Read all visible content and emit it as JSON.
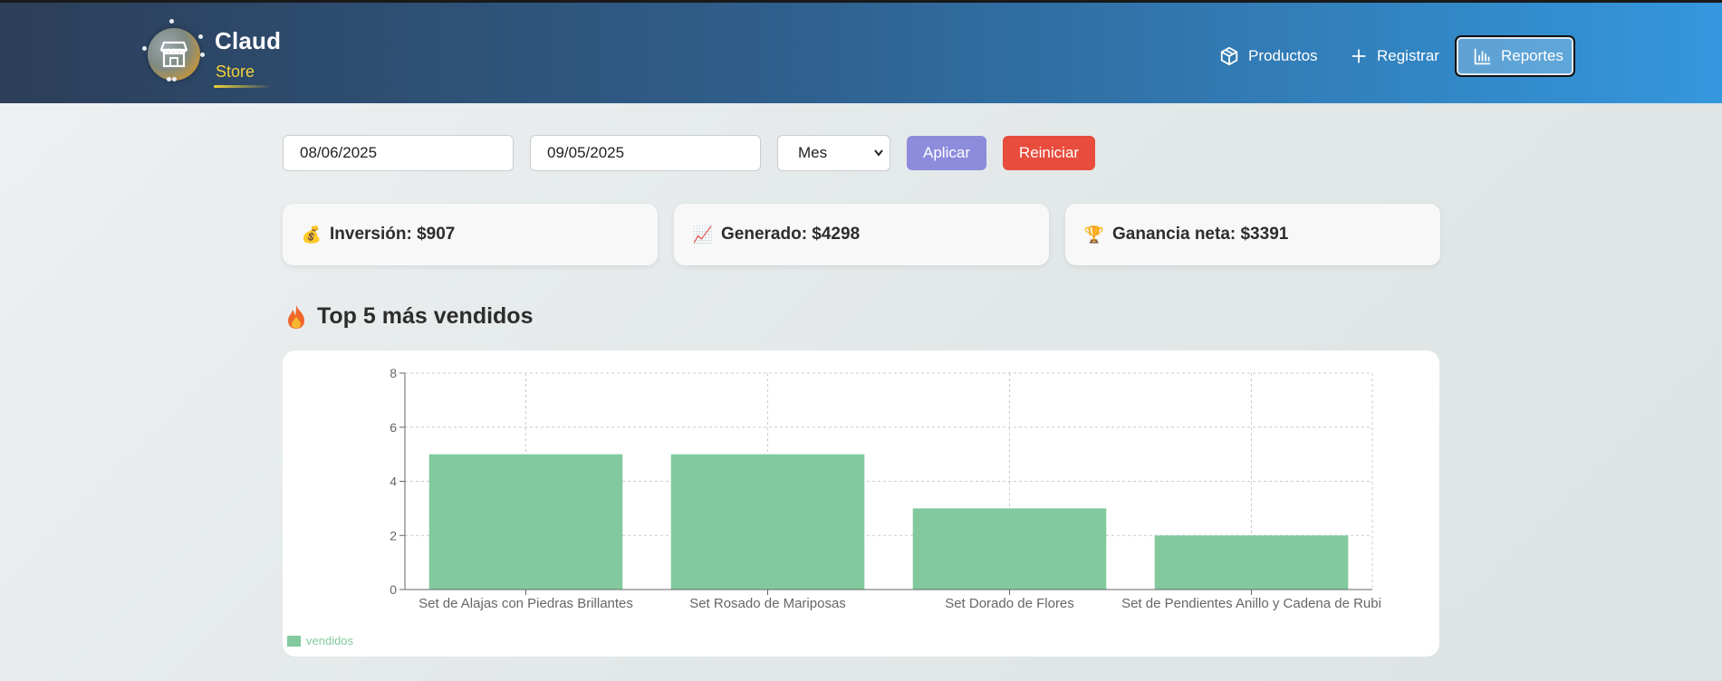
{
  "brand": {
    "name": "Claud",
    "subtitle": "Store",
    "accent": "#f1d23a"
  },
  "nav": [
    {
      "label": "Productos",
      "icon": "box-icon"
    },
    {
      "label": "Registrar",
      "icon": "plus-icon"
    },
    {
      "label": "Reportes",
      "icon": "bar-chart-icon",
      "active": true
    }
  ],
  "filters": {
    "start_date": "08/06/2025",
    "end_date": "09/05/2025",
    "period_selected": "Mes",
    "apply_label": "Aplicar",
    "reset_label": "Reiniciar"
  },
  "stats": [
    {
      "icon": "money-bag-icon",
      "emoji": "💰",
      "text": "Inversión: $907"
    },
    {
      "icon": "chart-increasing-icon",
      "emoji": "📈",
      "text": "Generado: $4298"
    },
    {
      "icon": "trophy-icon",
      "emoji": "🏆",
      "text": "Ganancia neta: $3391"
    }
  ],
  "section": {
    "icon": "fire-icon",
    "title": "Top 5 más vendidos"
  },
  "colors": {
    "bar": "#82ca9d",
    "apply": "#8d8bdc",
    "reset": "#e74c3c"
  },
  "chart_data": {
    "type": "bar",
    "categories": [
      "Set de Alajas con Piedras Brillantes",
      "Set Rosado de Mariposas",
      "Set Dorado de Flores",
      "Set de Pendientes Anillo y Cadena de Rubi"
    ],
    "series": [
      {
        "name": "vendidos",
        "values": [
          5,
          5,
          3,
          2
        ]
      }
    ],
    "yticks": [
      0,
      2,
      4,
      6,
      8
    ],
    "ylim": [
      0,
      8
    ],
    "grid": true,
    "legend": "bottom-left"
  }
}
